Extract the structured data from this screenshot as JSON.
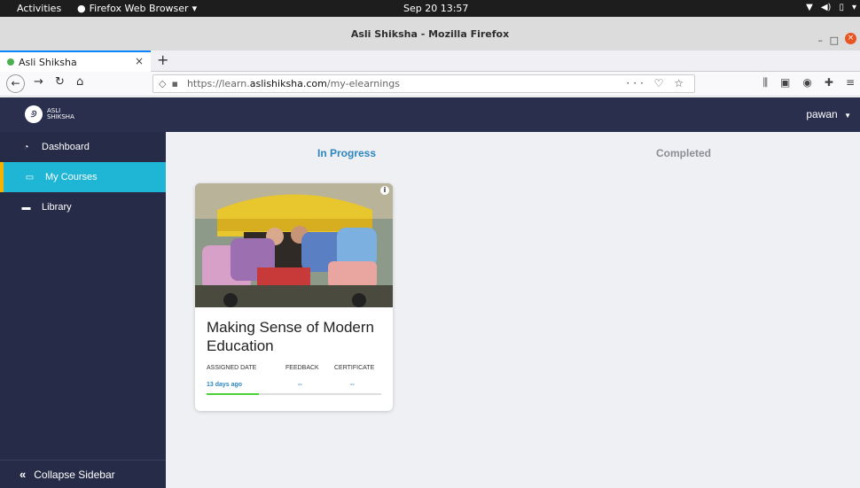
{
  "system": {
    "activities": "Activities",
    "app_menu": "Firefox Web Browser",
    "clock": "Sep 20  13:57"
  },
  "window": {
    "title": "Asli Shiksha - Mozilla Firefox"
  },
  "browser": {
    "tab_title": "Asli Shiksha",
    "url_prefix": "https://learn.",
    "url_host": "aslishiksha.com",
    "url_path": "/my-elearnings"
  },
  "app": {
    "logo_line1": "ASLI",
    "logo_line2": "SHIKSHA",
    "user": "pawan"
  },
  "sidebar": {
    "items": [
      {
        "label": "Dashboard",
        "icon": "dashboard-icon",
        "active": false
      },
      {
        "label": "My Courses",
        "icon": "courses-icon",
        "active": true
      },
      {
        "label": "Library",
        "icon": "library-icon",
        "active": false
      }
    ],
    "collapse_label": "Collapse Sidebar"
  },
  "main": {
    "tabs": [
      {
        "label": "In Progress",
        "active": true
      },
      {
        "label": "Completed",
        "active": false
      }
    ],
    "courses": [
      {
        "title": "Making Sense of Modern Education",
        "assigned_label": "ASSIGNED DATE",
        "feedback_label": "FEEDBACK",
        "certificate_label": "CERTIFICATE",
        "assigned_value": "13 days ago",
        "feedback_value": "--",
        "certificate_value": "--",
        "progress": 0.3
      }
    ]
  },
  "colors": {
    "header_bg": "#2a2f4e",
    "sidebar_bg": "#262b47",
    "active_item": "#1fb5d5",
    "accent": "#2e86c1",
    "progress": "#4cd137"
  }
}
